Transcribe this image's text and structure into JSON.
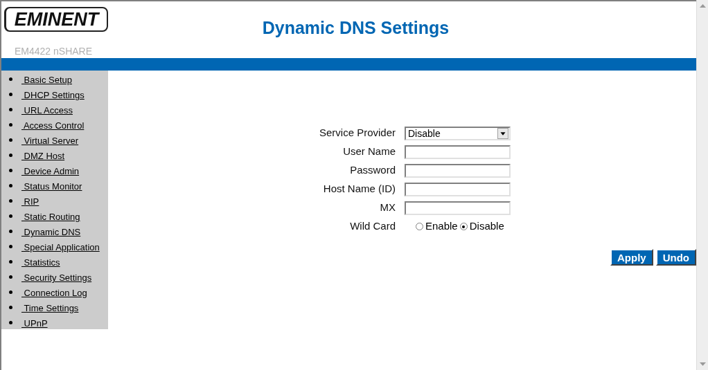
{
  "header": {
    "logo": "EMINENT",
    "model": "EM4422 nSHARE",
    "title": "Dynamic DNS Settings"
  },
  "sidebar": {
    "items": [
      {
        "label": " Basic Setup"
      },
      {
        "label": " DHCP Settings"
      },
      {
        "label": " URL Access"
      },
      {
        "label": " Access Control"
      },
      {
        "label": " Virtual Server"
      },
      {
        "label": " DMZ Host"
      },
      {
        "label": " Device Admin"
      },
      {
        "label": " Status Monitor"
      },
      {
        "label": " RIP"
      },
      {
        "label": " Static Routing"
      },
      {
        "label": " Dynamic DNS"
      },
      {
        "label": " Special Application"
      },
      {
        "label": " Statistics"
      },
      {
        "label": " Security Settings"
      },
      {
        "label": " Connection Log"
      },
      {
        "label": " Time Settings"
      },
      {
        "label": " UPnP"
      }
    ]
  },
  "form": {
    "fields": [
      {
        "kind": "select",
        "label": "Service Provider",
        "value": "Disable"
      },
      {
        "kind": "text",
        "label": "User Name"
      },
      {
        "kind": "text",
        "label": "Password"
      },
      {
        "kind": "text",
        "label": "Host Name (ID)"
      },
      {
        "kind": "text",
        "label": "MX"
      },
      {
        "kind": "radio",
        "label": "Wild Card",
        "options": [
          {
            "label": "Enable",
            "selected": false
          },
          {
            "label": "Disable",
            "selected": true
          }
        ]
      }
    ]
  },
  "buttons": [
    "Apply",
    "Undo"
  ]
}
